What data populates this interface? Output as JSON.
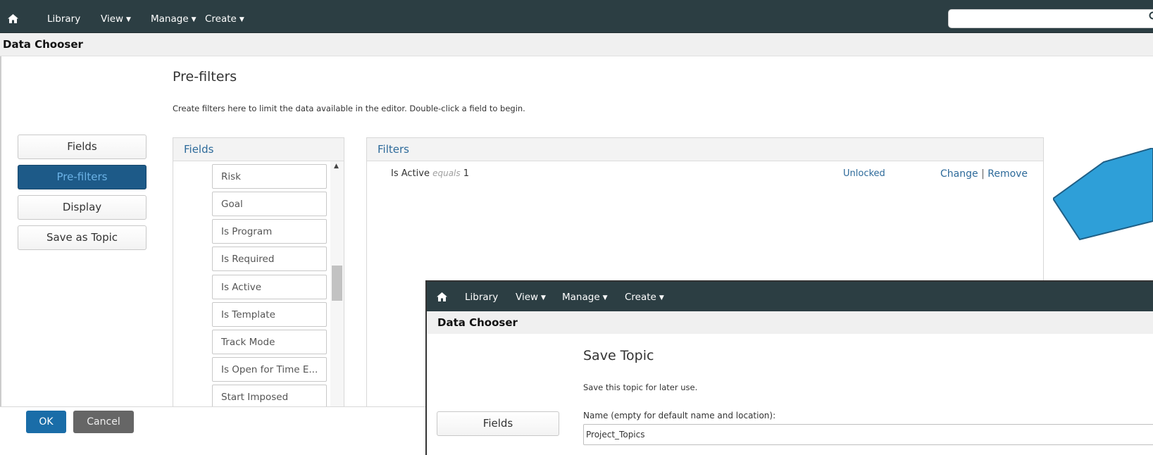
{
  "nav": {
    "items": [
      {
        "label": "Library",
        "dropdown": false
      },
      {
        "label": "View",
        "dropdown": true
      },
      {
        "label": "Manage",
        "dropdown": true
      },
      {
        "label": "Create",
        "dropdown": true
      }
    ],
    "home_icon": "home-icon",
    "search_icon": "search-icon",
    "search_value": ""
  },
  "titlebar": {
    "label": "Data Chooser"
  },
  "page": {
    "title": "Pre-filters",
    "description": "Create filters here to limit the data available in the editor. Double-click a field to begin."
  },
  "sidebar": {
    "items": [
      {
        "label": "Fields",
        "active": false
      },
      {
        "label": "Pre-filters",
        "active": true
      },
      {
        "label": "Display",
        "active": false
      },
      {
        "label": "Save as Topic",
        "active": false
      }
    ]
  },
  "fields_panel": {
    "header": "Fields",
    "items": [
      "Risk",
      "Goal",
      "Is Program",
      "Is Required",
      "Is Active",
      "Is Template",
      "Track Mode",
      "Is Open for Time E...",
      "Start Imposed"
    ]
  },
  "filters_panel": {
    "header": "Filters",
    "rows": [
      {
        "field": "Is Active",
        "operator": "equals",
        "value": "1",
        "lock_status": "Unlocked",
        "change_label": "Change",
        "separator": "|",
        "remove_label": "Remove"
      }
    ]
  },
  "footer": {
    "ok_label": "OK",
    "cancel_label": "Cancel"
  },
  "overlay": {
    "nav": {
      "items": [
        {
          "label": "Library",
          "dropdown": false
        },
        {
          "label": "View",
          "dropdown": true
        },
        {
          "label": "Manage",
          "dropdown": true
        },
        {
          "label": "Create",
          "dropdown": true
        }
      ]
    },
    "titlebar": "Data Chooser",
    "title": "Save Topic",
    "description": "Save this topic for later use.",
    "fields_button": "Fields",
    "name_label": "Name (empty for default name and location):",
    "name_value": "Project_Topics"
  },
  "colors": {
    "nav_bg": "#2c3e43",
    "accent_blue": "#1d5a88",
    "link_blue": "#2d6a9a",
    "ok_blue": "#1a6da8",
    "arrow_fill": "#2e9fd8"
  }
}
